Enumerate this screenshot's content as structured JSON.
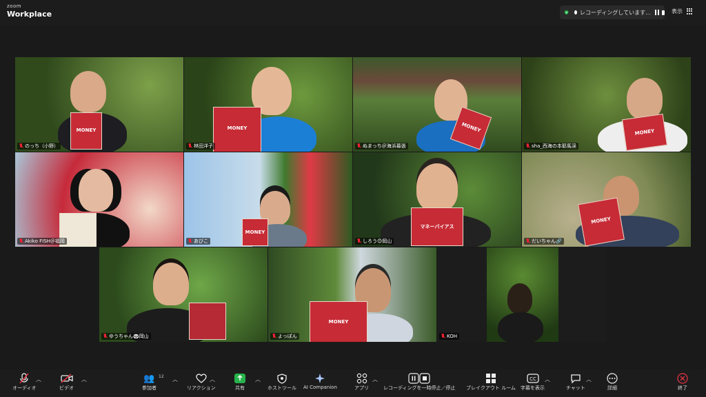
{
  "app": {
    "brand_top": "zoom",
    "brand_name": "Workplace"
  },
  "recording": {
    "status": "レコーディングしています..."
  },
  "view": {
    "label": "表示"
  },
  "participants": [
    {
      "name": "のっち（小野）"
    },
    {
      "name": "林田洋子"
    },
    {
      "name": "ぬまっち＠海浜幕張"
    },
    {
      "name": "sha_西海の本耶馬渓"
    },
    {
      "name": "Akiko FISH＠福岡"
    },
    {
      "name": "あびこ"
    },
    {
      "name": "しろう😊岡山"
    },
    {
      "name": "だいちゃん🔗"
    },
    {
      "name": "ゆうちゃん🐼岡山"
    },
    {
      "name": "よっぽん"
    },
    {
      "name": "KOH"
    }
  ],
  "book": {
    "title": "MONEY",
    "subtitle": "マネーバイアス"
  },
  "toolbar": {
    "audio": "オーディオ",
    "video": "ビデオ",
    "participants": "参加者",
    "participant_count": "12",
    "reaction": "リアクション",
    "share": "共有",
    "host_tools": "ホストツール",
    "ai": "AI Companion",
    "apps": "アプリ",
    "rec_pause": "レコーディングを一時停止／停止",
    "breakout": "ブレイクアウト ルーム",
    "captions": "字幕を表示",
    "chat": "チャット",
    "more": "詳細",
    "end": "終了"
  },
  "colors": {
    "active_speaker": "#27d26b",
    "muted": "#e23344",
    "book": "#c62b36",
    "share": "#27b34b"
  }
}
